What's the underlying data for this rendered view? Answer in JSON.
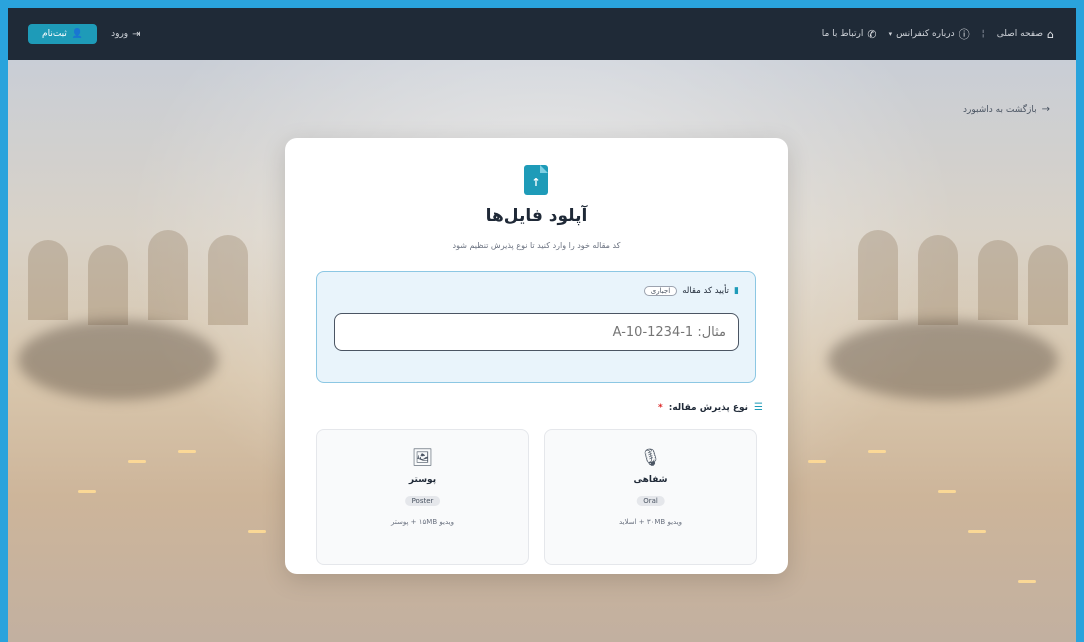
{
  "nav": {
    "home": "صفحه اصلی",
    "about": "درباره کنفرانس",
    "contact": "ارتباط با ما",
    "login": "ورود",
    "signup": "ثبت‌نام"
  },
  "back_link": "بازگشت به داشبورد",
  "card": {
    "title": "آپلود فایل‌ها",
    "subtitle": "کد مقاله خود را وارد کنید تا نوع پذیرش تنظیم شود",
    "code_label": "تأیید کد مقاله",
    "code_required_badge": "اجباری",
    "code_placeholder": "مثال: A-10-1234-1",
    "type_label": "نوع پذیرش مقاله:",
    "type_required_mark": "*"
  },
  "options": [
    {
      "icon": "microphone-icon",
      "name": "شفاهی",
      "badge": "Oral",
      "desc": "ویدیو ۳۰MB + اسلاید"
    },
    {
      "icon": "poster-icon",
      "name": "پوستر",
      "badge": "Poster",
      "desc": "ویدیو ۱۵MB + پوستر"
    }
  ],
  "colors": {
    "accent": "#1e9bb8",
    "navbar": "#1f2a37",
    "border_frame": "#2aa3dc"
  }
}
